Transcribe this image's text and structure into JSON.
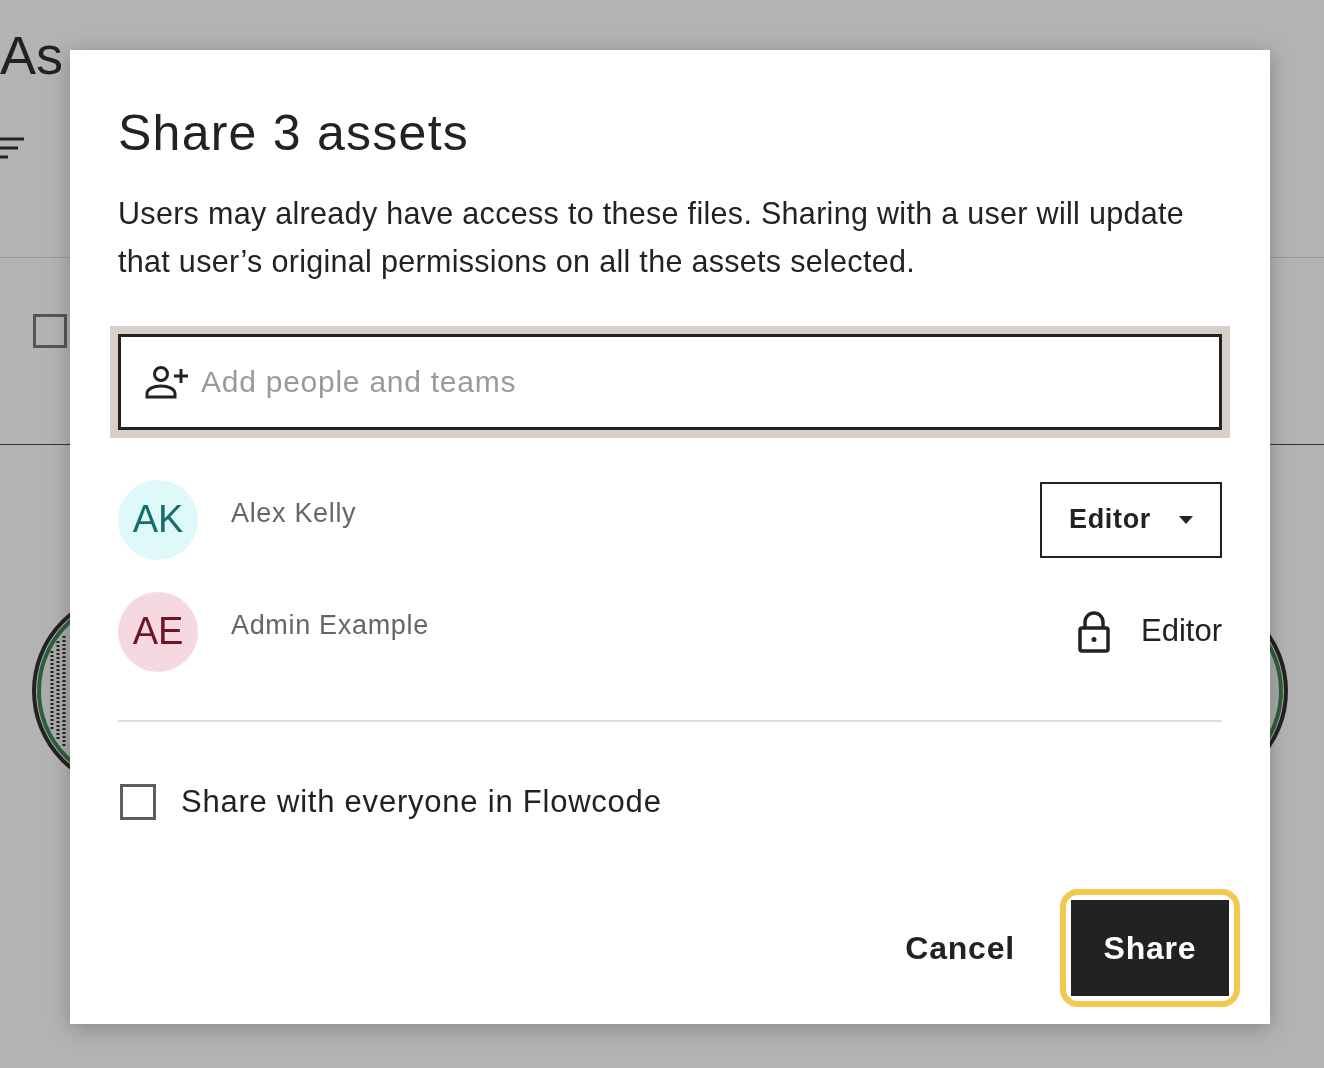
{
  "page": {
    "title": "As",
    "select_all": {
      "checked": false
    }
  },
  "dialog": {
    "title": "Share 3 assets",
    "description": "Users may already have access to these files. Sharing with a user will update that user’s original permissions on all the assets selected.",
    "search": {
      "placeholder": "Add people and teams",
      "focused": true
    },
    "members": [
      {
        "initials": "AK",
        "name": "Alex Kelly",
        "color": "#dff8f8",
        "role": "Editor",
        "kind": "dropdown"
      },
      {
        "initials": "AE",
        "name": "Admin Example",
        "color": "#f6d9e0",
        "role": "Editor",
        "kind": "locked"
      }
    ],
    "share_all": {
      "label": "Share with everyone in Flowcode",
      "checked": false
    },
    "buttons": [
      {
        "label": "Cancel",
        "kind": "text",
        "focused": false
      },
      {
        "label": "Share",
        "kind": "primary",
        "focused": true
      }
    ]
  }
}
